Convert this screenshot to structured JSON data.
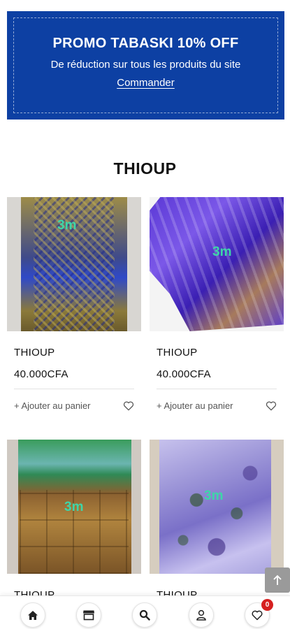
{
  "promo": {
    "title": "PROMO TABASKI 10% OFF",
    "subtitle": "De réduction sur tous les produits du site",
    "link": "Commander",
    "background": "#0d40a3"
  },
  "section": {
    "title": "THIOUP"
  },
  "products": [
    {
      "name": "THIOUP",
      "price": "40.000CFA",
      "add_label": "+ Ajouter au panier",
      "image_tag": "3m"
    },
    {
      "name": "THIOUP",
      "price": "40.000CFA",
      "add_label": "+ Ajouter au panier",
      "image_tag": "3m"
    },
    {
      "name": "THIOUP",
      "price": "",
      "add_label": "",
      "image_tag": "3m"
    },
    {
      "name": "THIOUP",
      "price": "",
      "add_label": "",
      "image_tag": "3m"
    }
  ],
  "bottom_nav": {
    "items": [
      "home-icon",
      "store-icon",
      "search-icon",
      "user-icon",
      "heart-icon"
    ],
    "wishlist_count": "0"
  },
  "icons": {
    "scroll_top": "arrow-up-icon",
    "wishlist": "heart-outline-icon"
  }
}
